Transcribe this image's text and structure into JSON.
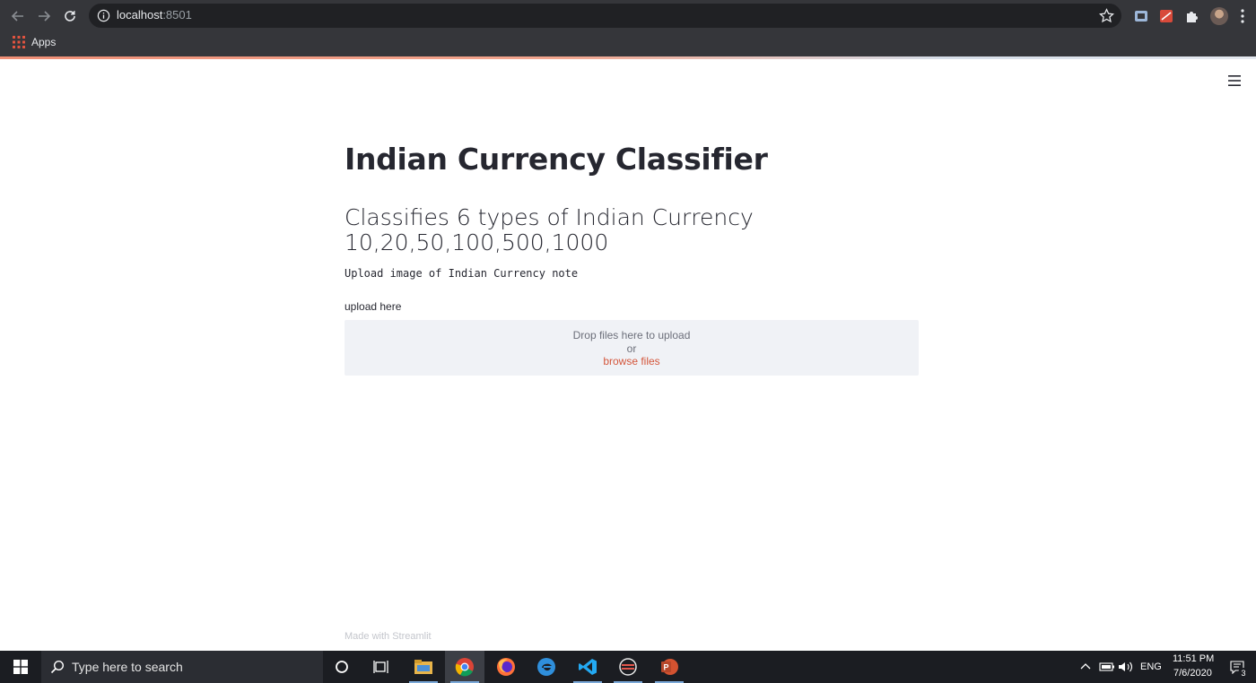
{
  "browser": {
    "url_host": "localhost",
    "url_port": ":8501",
    "bookmarks_apps_label": "Apps"
  },
  "page": {
    "title": "Indian Currency Classifier",
    "subheader": "Classifies 6 types of Indian Currency 10,20,50,100,500,1000",
    "instruction": "Upload image of Indian Currency note",
    "uploader": {
      "label": "upload here",
      "drop_text": "Drop files here to upload",
      "or_text": "or",
      "browse_label": "browse files"
    },
    "footer": "Made with Streamlit"
  },
  "taskbar": {
    "search_placeholder": "Type here to search",
    "language": "ENG",
    "time": "11:51 PM",
    "date": "7/6/2020",
    "notification_count": "3"
  },
  "colors": {
    "accent": "#d4563b",
    "text": "#262730",
    "dropzone_bg": "#f0f2f6",
    "browser_chrome": "#35363a"
  },
  "icons": [
    "back-icon",
    "forward-icon",
    "reload-icon",
    "info-icon",
    "star-icon",
    "extension-icon",
    "puzzle-icon",
    "avatar",
    "menu-dots-icon",
    "apps-icon",
    "hamburger-icon",
    "windows-start-icon",
    "search-icon",
    "cortana-icon",
    "task-view-icon",
    "file-explorer-icon",
    "chrome-icon",
    "firefox-icon",
    "edge-icon",
    "vscode-icon",
    "eclipse-icon",
    "powerpoint-icon",
    "notification-icon"
  ]
}
